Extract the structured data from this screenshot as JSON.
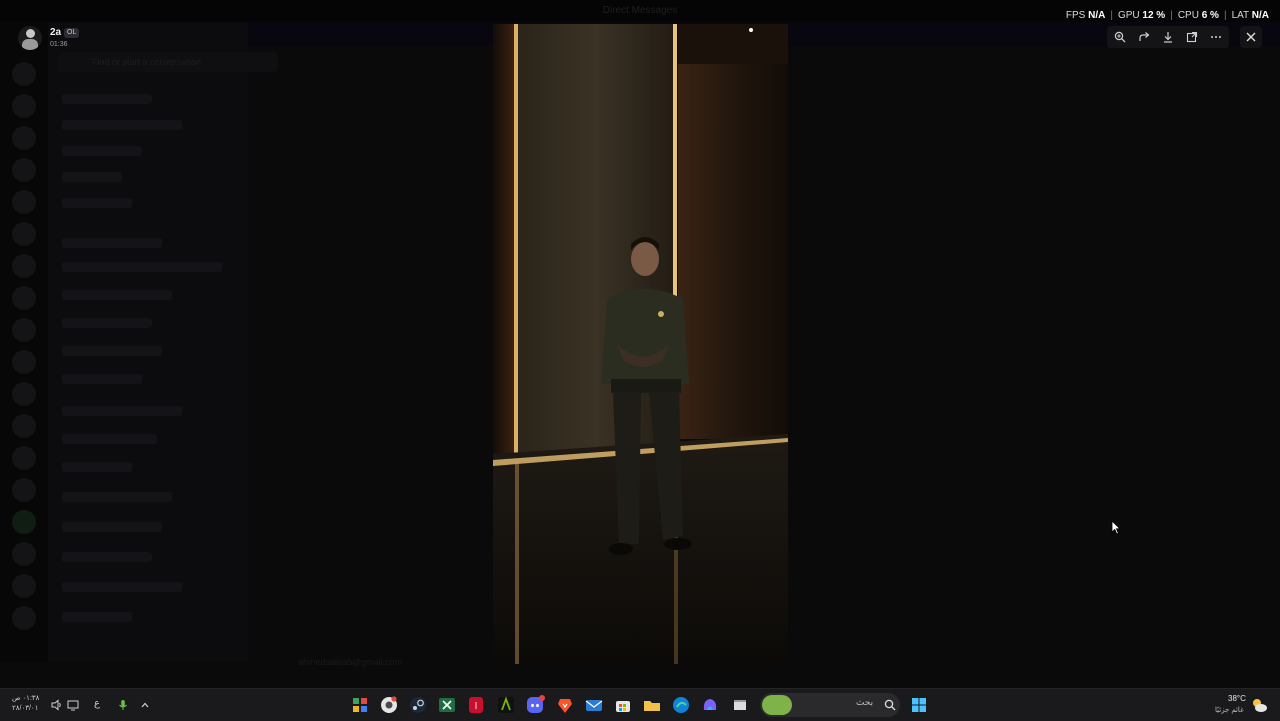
{
  "background_app": {
    "title": "Direct Messages",
    "search_placeholder": "Find or start a conversation",
    "footer_email": "ahmedsaleab@gmail.com"
  },
  "user_overlay": {
    "name": "2a",
    "badge": "OL",
    "elapsed": "01:36"
  },
  "perf_overlay": {
    "fps_label": "FPS",
    "fps_value": "N/A",
    "gpu_label": "GPU",
    "gpu_value": "12 %",
    "cpu_label": "CPU",
    "cpu_value": "6 %",
    "lat_label": "LAT",
    "lat_value": "N/A"
  },
  "viewer_toolbar": {
    "buttons": [
      "zoom-in-icon",
      "forward-icon",
      "download-icon",
      "open-external-icon",
      "more-icon"
    ],
    "close": "close-icon"
  },
  "taskbar": {
    "clock_time": "٠١:٣٨ ص",
    "clock_date": "٢٨/٠٣/٠١",
    "language": "ع",
    "search_text": "بحث",
    "weather_temp": "38°C",
    "weather_desc": "غائم جزئيًا",
    "apps": [
      "app-grid-icon",
      "chrome-icon",
      "steam-icon",
      "excel-icon",
      "red-app-icon",
      "nvidia-icon",
      "discord-icon",
      "brave-icon",
      "mail-icon",
      "store-icon",
      "file-explorer-icon",
      "edge-icon",
      "copilot-icon",
      "window-icon",
      "search-decoration-icon"
    ],
    "colors": {
      "discord": "#5865f2",
      "brave": "#fb542b",
      "windows": "#4cc2ff"
    }
  }
}
